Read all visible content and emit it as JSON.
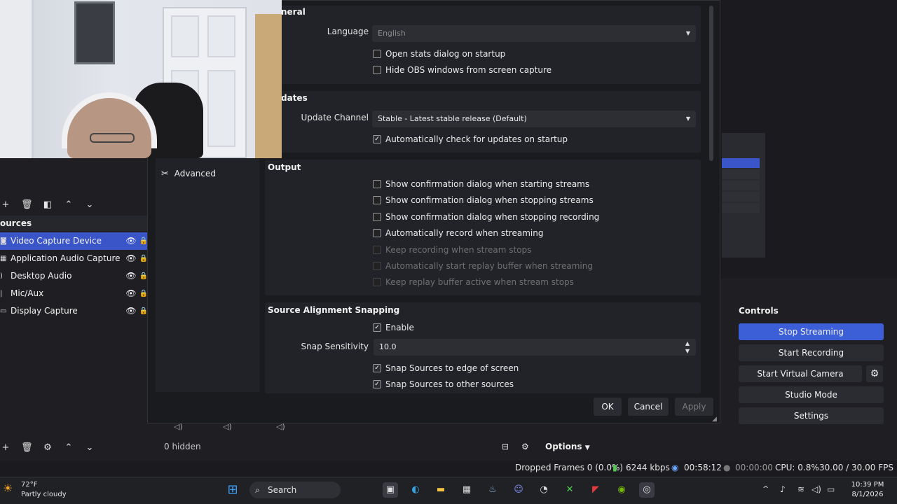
{
  "settings": {
    "general": {
      "title_partial": "neral",
      "language_label": "Language",
      "language_value": "English",
      "open_stats": "Open stats dialog on startup",
      "hide_obs": "Hide OBS windows from screen capture"
    },
    "updates": {
      "title_partial": "dates",
      "channel_label": "Update Channel",
      "channel_value": "Stable - Latest stable release (Default)",
      "auto_check": "Automatically check for updates on startup"
    },
    "nav": {
      "advanced": "Advanced"
    },
    "output": {
      "title": "Output",
      "items": [
        {
          "label": "Show confirmation dialog when starting streams",
          "checked": false,
          "disabled": false
        },
        {
          "label": "Show confirmation dialog when stopping streams",
          "checked": false,
          "disabled": false
        },
        {
          "label": "Show confirmation dialog when stopping recording",
          "checked": false,
          "disabled": false
        },
        {
          "label": "Automatically record when streaming",
          "checked": false,
          "disabled": false
        },
        {
          "label": "Keep recording when stream stops",
          "checked": false,
          "disabled": true
        },
        {
          "label": "Automatically start replay buffer when streaming",
          "checked": false,
          "disabled": true
        },
        {
          "label": "Keep replay buffer active when stream stops",
          "checked": false,
          "disabled": true
        }
      ]
    },
    "snapping": {
      "title": "Source Alignment Snapping",
      "enable": "Enable",
      "sensitivity_label": "Snap Sensitivity",
      "sensitivity_value": "10.0",
      "edge": "Snap Sources to edge of screen",
      "other": "Snap Sources to other sources"
    },
    "buttons": {
      "ok": "OK",
      "cancel": "Cancel",
      "apply": "Apply"
    }
  },
  "sources": {
    "header": "ources",
    "items": [
      {
        "name": "Video Capture Device",
        "selected": true
      },
      {
        "name": "Application Audio Capture (BET",
        "selected": false
      },
      {
        "name": "Desktop Audio",
        "selected": false
      },
      {
        "name": "Mic/Aux",
        "selected": false
      },
      {
        "name": "Display Capture",
        "selected": false
      }
    ]
  },
  "controls": {
    "title": "Controls",
    "stop_streaming": "Stop Streaming",
    "start_recording": "Start Recording",
    "start_virtual_camera": "Start Virtual Camera",
    "studio_mode": "Studio Mode",
    "settings": "Settings"
  },
  "mixer": {
    "hidden": "0 hidden",
    "options": "Options"
  },
  "status": {
    "dropped_frames": "Dropped Frames 0 (0.0%)",
    "bitrate": "6244 kbps",
    "stream_time": "00:58:12",
    "record_time": "00:00:00",
    "cpu": "CPU: 0.8%",
    "fps": "30.00 / 30.00 FPS"
  },
  "taskbar": {
    "temp": "72°F",
    "weather": "Partly cloudy",
    "search": "Search",
    "time": "10:39 PM",
    "date": "8/1/2026"
  },
  "colors": {
    "accent": "#3955c8",
    "active_button": "#3c5fd8"
  }
}
